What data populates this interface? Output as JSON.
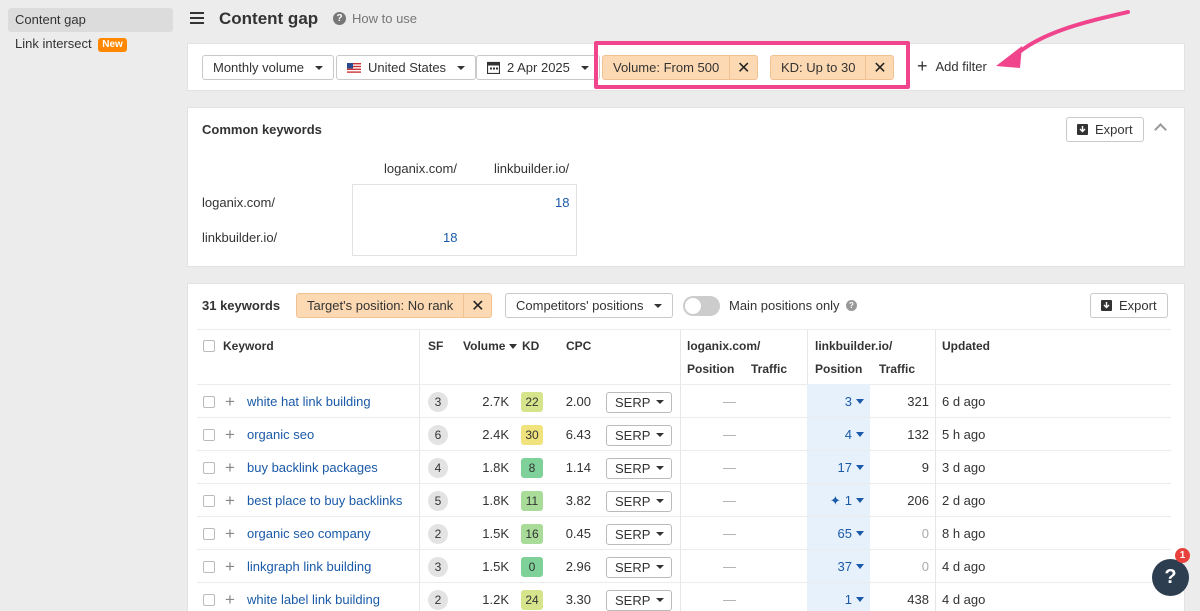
{
  "sidebar": {
    "items": [
      {
        "label": "Content gap"
      },
      {
        "label": "Link intersect",
        "badge": "New"
      }
    ]
  },
  "header": {
    "title": "Content gap",
    "help_label": "How to use"
  },
  "filters": {
    "volume_mode": "Monthly volume",
    "country": "United States",
    "date": "2 Apr 2025",
    "active": [
      {
        "label": "Volume: From 500"
      },
      {
        "label": "KD: Up to 30"
      }
    ],
    "add_filter_label": "Add filter",
    "highlight_color": "#f0448c"
  },
  "common_keywords": {
    "title": "Common keywords",
    "export_label": "Export",
    "columns": [
      "loganix.com/",
      "linkbuilder.io/"
    ],
    "rows": [
      {
        "name": "loganix.com/",
        "values": [
          "",
          "18"
        ]
      },
      {
        "name": "linkbuilder.io/",
        "values": [
          "18",
          ""
        ]
      }
    ]
  },
  "keywords_table": {
    "count_label": "31 keywords",
    "target_filter": "Target's position: No rank",
    "competitors_dropdown": "Competitors' positions",
    "main_positions_label": "Main positions only",
    "main_positions_on": false,
    "export_label": "Export",
    "headers": {
      "keyword": "Keyword",
      "sf": "SF",
      "volume": "Volume",
      "kd": "KD",
      "cpc": "CPC",
      "site1": "loganix.com/",
      "site2": "linkbuilder.io/",
      "position": "Position",
      "traffic": "Traffic",
      "updated": "Updated"
    },
    "rows": [
      {
        "keyword": "white hat link building",
        "sf": "3",
        "volume": "2.7K",
        "kd": "22",
        "kd_color": "#d6e48c",
        "cpc": "2.00",
        "serp": "SERP",
        "site1_pos": "—",
        "site2_pos": "3",
        "site2_traffic": "321",
        "updated": "6 d ago",
        "sparkle": false
      },
      {
        "keyword": "organic seo",
        "sf": "6",
        "volume": "2.4K",
        "kd": "30",
        "kd_color": "#f0e27d",
        "cpc": "6.43",
        "serp": "SERP",
        "site1_pos": "—",
        "site2_pos": "4",
        "site2_traffic": "132",
        "updated": "5 h ago",
        "sparkle": false
      },
      {
        "keyword": "buy backlink packages",
        "sf": "4",
        "volume": "1.8K",
        "kd": "8",
        "kd_color": "#7fd19a",
        "cpc": "1.14",
        "serp": "SERP",
        "site1_pos": "—",
        "site2_pos": "17",
        "site2_traffic": "9",
        "updated": "3 d ago",
        "sparkle": false
      },
      {
        "keyword": "best place to buy backlinks",
        "sf": "5",
        "volume": "1.8K",
        "kd": "11",
        "kd_color": "#a8dc98",
        "cpc": "3.82",
        "serp": "SERP",
        "site1_pos": "—",
        "site2_pos": "1",
        "site2_traffic": "206",
        "updated": "2 d ago",
        "sparkle": true
      },
      {
        "keyword": "organic seo company",
        "sf": "2",
        "volume": "1.5K",
        "kd": "16",
        "kd_color": "#a8dc98",
        "cpc": "0.45",
        "serp": "SERP",
        "site1_pos": "—",
        "site2_pos": "65",
        "site2_traffic": "0",
        "updated": "8 h ago",
        "sparkle": false
      },
      {
        "keyword": "linkgraph link building",
        "sf": "3",
        "volume": "1.5K",
        "kd": "0",
        "kd_color": "#7fd19a",
        "cpc": "2.96",
        "serp": "SERP",
        "site1_pos": "—",
        "site2_pos": "37",
        "site2_traffic": "0",
        "updated": "4 d ago",
        "sparkle": false
      },
      {
        "keyword": "white label link building",
        "sf": "2",
        "volume": "1.2K",
        "kd": "24",
        "kd_color": "#d6e48c",
        "cpc": "3.30",
        "serp": "SERP",
        "site1_pos": "—",
        "site2_pos": "1",
        "site2_traffic": "438",
        "updated": "4 d ago",
        "sparkle": false
      }
    ]
  },
  "help_fab": {
    "label": "?",
    "badge": "1"
  }
}
